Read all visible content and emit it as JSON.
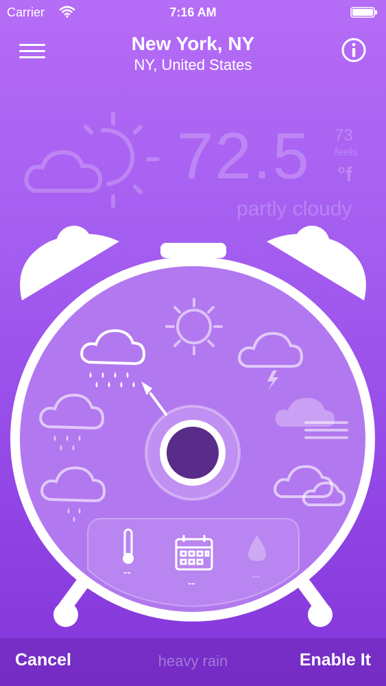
{
  "status_bar": {
    "carrier": "Carrier",
    "time": "7:16 AM",
    "wifi_icon": "wifi-icon",
    "battery_icon": "battery-icon"
  },
  "header": {
    "city": "New York, NY",
    "region": "NY, United States",
    "menu_icon": "hamburger-menu-icon",
    "info_icon": "info-icon"
  },
  "current": {
    "temperature": "72.5",
    "feels_like": "73",
    "feels_label": "feels",
    "unit": "°f",
    "condition": "partly cloudy",
    "icon": "partly-cloudy-icon"
  },
  "dial": {
    "options": [
      {
        "name": "heavy rain",
        "icon": "heavy-rain-icon"
      },
      {
        "name": "sunny",
        "icon": "sun-icon"
      },
      {
        "name": "thunderstorm",
        "icon": "thunderstorm-icon"
      },
      {
        "name": "fog",
        "icon": "fog-icon"
      },
      {
        "name": "cloudy",
        "icon": "cloudy-icon"
      },
      {
        "name": "light rain",
        "icon": "light-rain-icon"
      },
      {
        "name": "rain",
        "icon": "rain-icon"
      }
    ],
    "stats": {
      "temperature": "--",
      "date": "--",
      "humidity": "--"
    }
  },
  "footer": {
    "cancel_label": "Cancel",
    "selected_condition": "heavy rain",
    "enable_label": "Enable It"
  },
  "colors": {
    "background_top": "#b56cf6",
    "background_bottom": "#8335d8",
    "dial_face": "#b278ef",
    "knob_center": "#5a2c8a"
  }
}
